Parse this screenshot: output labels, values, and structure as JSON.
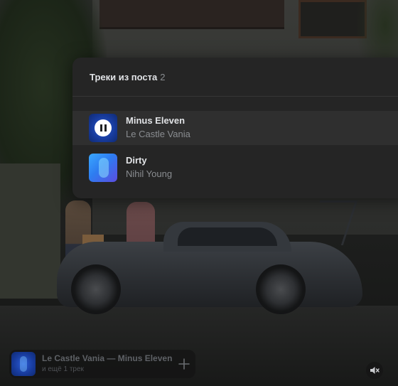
{
  "popup": {
    "title": "Треки из поста",
    "count": "2"
  },
  "tracks": [
    {
      "title": "Minus Eleven",
      "artist": "Le Castle Vania",
      "playing": true,
      "cover_icon": "album-cover"
    },
    {
      "title": "Dirty",
      "artist": "Nihil Young",
      "playing": false,
      "cover_icon": "album-cover"
    }
  ],
  "mini_player": {
    "title": "Le Castle Vania — Minus Eleven",
    "subtitle": "и ещё 1 трек",
    "add_icon": "plus-icon"
  },
  "volume_icon": "speaker-muted-icon",
  "colors": {
    "popup_bg": "#252525",
    "active_row": "#2f2f2f",
    "text_primary": "#e1e3e6",
    "text_secondary": "#8a8d91"
  }
}
